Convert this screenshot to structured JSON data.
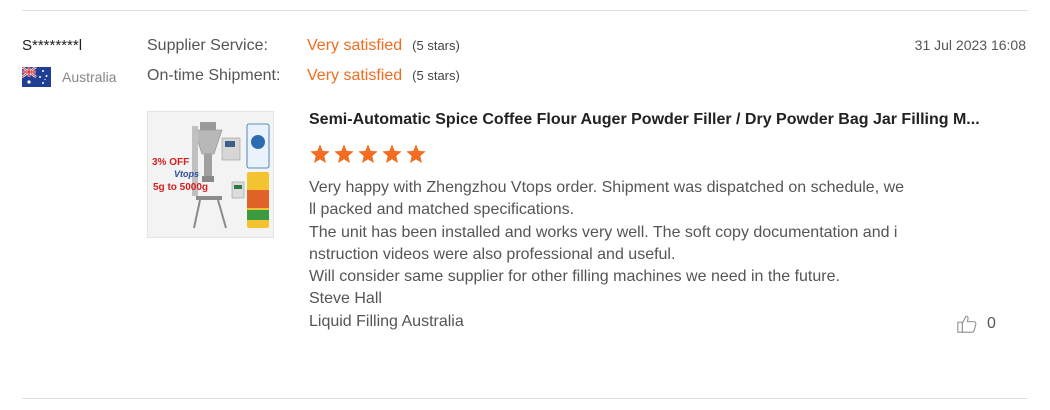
{
  "review": {
    "reviewer_name": "S********l",
    "country": "Australia",
    "date": "31 Jul 2023 16:08",
    "ratings": [
      {
        "label": "Supplier Service:",
        "value": "Very satisfied",
        "stars_text": "(5 stars)"
      },
      {
        "label": "On-time Shipment:",
        "value": "Very satisfied",
        "stars_text": "(5 stars)"
      }
    ],
    "product": {
      "title": "Semi-Automatic Spice Coffee Flour Auger Powder Filler / Dry Powder Bag Jar Filling M...",
      "image_labels": {
        "discount": "3% OFF",
        "brand": "Vtops",
        "range": "5g to 5000g"
      }
    },
    "star_rating": 5,
    "star_color": "#f36c21",
    "accent_color": "#f36c21",
    "body_lines": [
      "Very happy with Zhengzhou Vtops order. Shipment was dispatched on schedule, we",
      "ll packed and matched specifications.",
      "The unit has been installed and works very well. The soft copy documentation and i",
      "nstruction videos were also professional and useful.",
      "Will consider same supplier for other filling machines we need in the future.",
      "Steve Hall",
      "Liquid Filling Australia"
    ],
    "like_count": "0",
    "icons": {
      "flag": "australia-flag-icon",
      "star": "star-icon",
      "like": "thumbs-up-icon"
    }
  }
}
